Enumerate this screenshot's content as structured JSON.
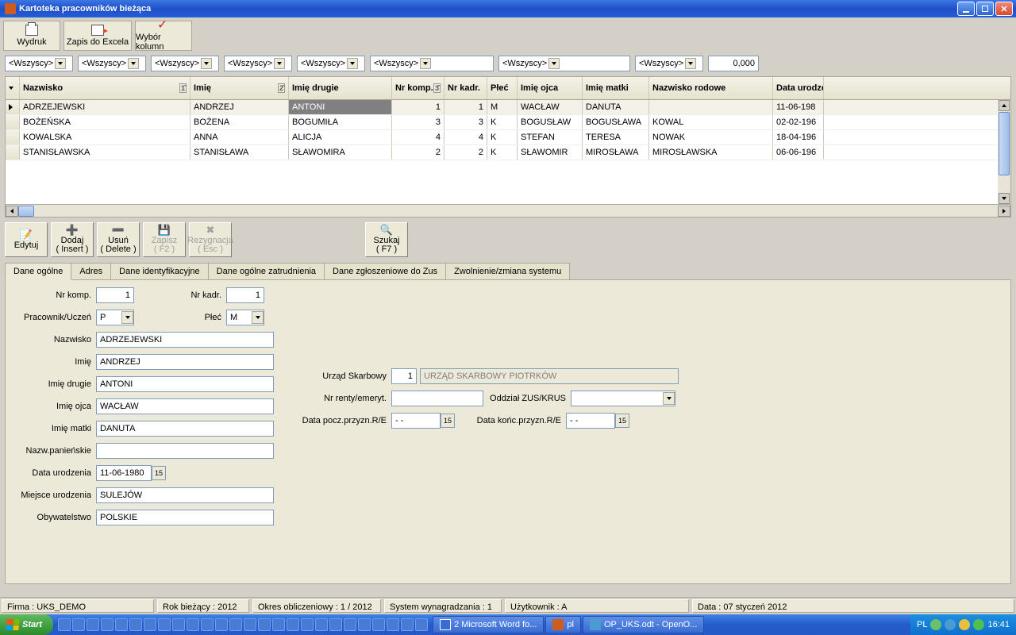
{
  "window": {
    "title": "Kartoteka pracowników bieżąca"
  },
  "toolbar": {
    "print": "Wydruk",
    "excel": "Zapis do Excela",
    "cols": "Wybór kolumn"
  },
  "filters": {
    "all_label": "<Wszyscy>",
    "num": "0,000"
  },
  "grid": {
    "headers": [
      "",
      "Nazwisko",
      "Imię",
      "Imię drugie",
      "Nr komp.",
      "Nr kadr.",
      "Płeć",
      "Imię ojca",
      "Imię matki",
      "Nazwisko rodowe",
      "Data urodzeni"
    ],
    "rows": [
      {
        "nazwisko": "ADRZEJEWSKI",
        "imie": "ANDRZEJ",
        "imie2": "ANTONI",
        "nrkomp": "1",
        "nrkadr": "1",
        "plec": "M",
        "ojciec": "WACŁAW",
        "matka": "DANUTA",
        "rodowe": "",
        "data": "11-06-198",
        "cur": true,
        "selcell": "imie2"
      },
      {
        "nazwisko": "BOŻEŃSKA",
        "imie": "BOŻENA",
        "imie2": "BOGUMIŁA",
        "nrkomp": "3",
        "nrkadr": "3",
        "plec": "K",
        "ojciec": "BOGUSŁAW",
        "matka": "BOGUSŁAWA",
        "rodowe": "KOWAL",
        "data": "02-02-196"
      },
      {
        "nazwisko": "KOWALSKA",
        "imie": "ANNA",
        "imie2": "ALICJA",
        "nrkomp": "4",
        "nrkadr": "4",
        "plec": "K",
        "ojciec": "STEFAN",
        "matka": "TERESA",
        "rodowe": "NOWAK",
        "data": "18-04-196"
      },
      {
        "nazwisko": "STANISŁAWSKA",
        "imie": "STANISŁAWA",
        "imie2": "SŁAWOMIRA",
        "nrkomp": "2",
        "nrkadr": "2",
        "plec": "K",
        "ojciec": "SŁAWOMIR",
        "matka": "MIROSŁAWA",
        "rodowe": "MIROSŁAWSKA",
        "data": "06-06-196"
      }
    ]
  },
  "actions": {
    "edit": "Edytuj",
    "add": "Dodaj",
    "add2": "( Insert )",
    "del": "Usuń",
    "del2": "( Delete )",
    "save": "Zapisz",
    "save2": "( F2 )",
    "cancel": "Rezygnacja",
    "cancel2": "( Esc )",
    "find": "Szukaj",
    "find2": "( F7 )"
  },
  "tabs": [
    "Dane ogólne",
    "Adres",
    "Dane identyfikacyjne",
    "Dane ogólne zatrudnienia",
    "Dane zgłoszeniowe do Zus",
    "Zwolnienie/zmiana systemu"
  ],
  "form": {
    "labels": {
      "nrkomp": "Nr komp.",
      "nrkadr": "Nr kadr.",
      "pracownik": "Pracownik/Uczeń",
      "plec": "Płeć",
      "nazwisko": "Nazwisko",
      "imie": "Imię",
      "imie2": "Imię drugie",
      "ojciec": "Imię ojca",
      "matka": "Imię matki",
      "panienskie": "Nazw.panieńskie",
      "dataur": "Data urodzenia",
      "miejsce": "Miejsce urodzenia",
      "obyw": "Obywatelstwo",
      "urzad": "Urząd Skarbowy",
      "renta": "Nr renty/emeryt.",
      "oddzial": "Oddział ZUS/KRUS",
      "datapocz": "Data pocz.przyzn.R/E",
      "datakonc": "Data końc.przyzn.R/E"
    },
    "values": {
      "nrkomp": "1",
      "nrkadr": "1",
      "pracownik": "P",
      "plec": "M",
      "nazwisko": "ADRZEJEWSKI",
      "imie": "ANDRZEJ",
      "imie2": "ANTONI",
      "ojciec": "WACŁAW",
      "matka": "DANUTA",
      "panienskie": "",
      "dataur": "11-06-1980",
      "miejsce": "SULEJÓW",
      "obyw": "POLSKIE",
      "urzad_nr": "1",
      "urzad_name": "URZĄD SKARBOWY PIOTRKÓW",
      "renta": "",
      "oddzial": "",
      "datapocz": "- -",
      "datakonc": "- -"
    }
  },
  "status": {
    "firma": "Firma : UKS_DEMO",
    "rok": "Rok bieżący : 2012",
    "okres": "Okres obliczeniowy : 1 / 2012",
    "system": "System wynagradzania : 1",
    "user": "Użytkownik : A",
    "data": "Data : 07 styczeń 2012"
  },
  "taskbar": {
    "start": "Start",
    "tasks": [
      "2 Microsoft Word fo...",
      "pl",
      "OP_UKS.odt - OpenO..."
    ],
    "lang": "PL",
    "time": "16:41"
  }
}
